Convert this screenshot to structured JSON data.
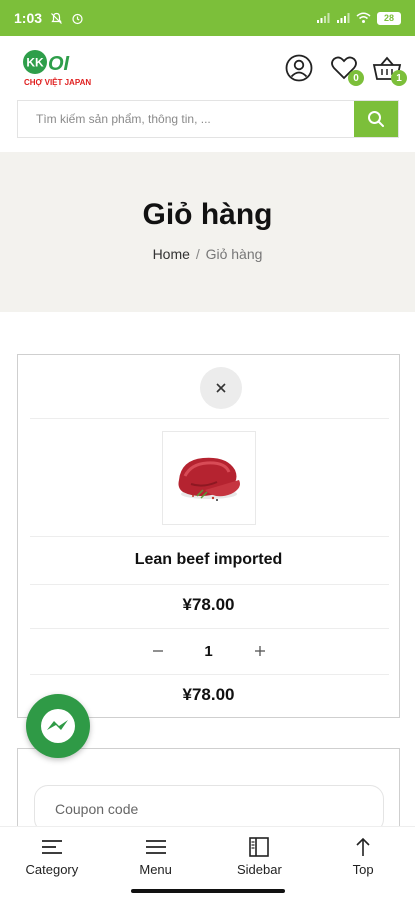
{
  "status_bar": {
    "time": "1:03",
    "battery": "28",
    "bg_color": "#7cbf3a"
  },
  "header": {
    "logo_text": "KKOI",
    "logo_sub": "CHỢ VIỆT JAPAN",
    "wishlist_count": "0",
    "cart_count": "1",
    "icons": [
      "user-icon",
      "heart-icon",
      "basket-icon"
    ]
  },
  "search": {
    "placeholder": "Tìm kiếm sản phẩm, thông tin, ...",
    "button_icon": "search-icon"
  },
  "banner": {
    "title": "Giỏ hàng",
    "breadcrumb_home": "Home",
    "breadcrumb_sep": "/",
    "breadcrumb_current": "Giỏ hàng"
  },
  "cart": {
    "remove_icon": "close-icon",
    "item_name": "Lean beef imported",
    "item_price": "¥78.00",
    "quantity": "1",
    "subtotal": "¥78.00"
  },
  "coupon": {
    "placeholder": "Coupon code"
  },
  "bottom_nav": {
    "items": [
      {
        "label": "Category",
        "icon": "category-icon"
      },
      {
        "label": "Menu",
        "icon": "menu-icon"
      },
      {
        "label": "Sidebar",
        "icon": "sidebar-icon"
      },
      {
        "label": "Top",
        "icon": "arrow-up-icon"
      }
    ]
  },
  "colors": {
    "accent": "#7cbf3a",
    "messenger": "#2f9a46",
    "banner_bg": "#f3f2ee"
  }
}
